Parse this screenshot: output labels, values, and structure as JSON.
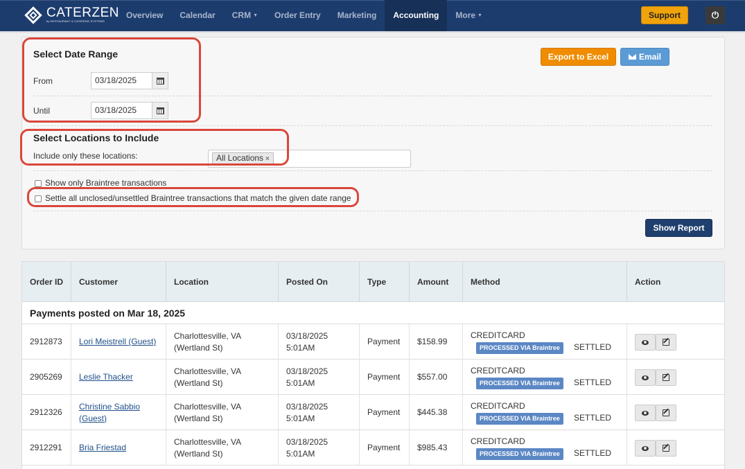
{
  "nav": {
    "brand": "CATERZEN",
    "brand_tag": "by RESTAURANT & CATERING SYSTEMS",
    "links": [
      {
        "label": "Overview"
      },
      {
        "label": "Calendar"
      },
      {
        "label": "CRM",
        "caret": "▼"
      },
      {
        "label": "Order Entry"
      },
      {
        "label": "Marketing"
      },
      {
        "label": "Accounting",
        "active": true
      },
      {
        "label": "More",
        "caret": "▼"
      }
    ],
    "support_label": "Support",
    "power_icon": "⏻"
  },
  "filters": {
    "date_heading": "Select Date Range",
    "from_label": "From",
    "from_value": "03/18/2025",
    "until_label": "Until",
    "until_value": "03/18/2025",
    "locations_heading": "Select Locations to Include",
    "locations_label": "Include only these locations:",
    "location_chip": "All Locations",
    "chip_remove": "×",
    "braintree_only_label": "Show only Braintree transactions",
    "settle_label": "Settle all unclosed/unsettled Braintree transactions that match the given date range",
    "export_label": "Export to Excel",
    "email_label": "Email",
    "show_report_label": "Show Report"
  },
  "table": {
    "headers": {
      "order_id": "Order ID",
      "customer": "Customer",
      "location": "Location",
      "posted_on": "Posted On",
      "type": "Type",
      "amount": "Amount",
      "method": "Method",
      "action": "Action"
    },
    "group_label": "Payments posted on Mar 18, 2025",
    "rows": [
      {
        "order_id": "2912873",
        "customer": "Lori Meistrell (Guest)",
        "location": "Charlottesville, VA (Wertland St)",
        "date": "03/18/2025",
        "time": "5:01AM",
        "type": "Payment",
        "amount": "$158.99",
        "method": "CREDITCARD",
        "badge": "PROCESSED VIA Braintree",
        "status": "SETTLED"
      },
      {
        "order_id": "2905269",
        "customer": "Leslie Thacker",
        "location": "Charlottesville, VA (Wertland St)",
        "date": "03/18/2025",
        "time": "5:01AM",
        "type": "Payment",
        "amount": "$557.00",
        "method": "CREDITCARD",
        "badge": "PROCESSED VIA Braintree",
        "status": "SETTLED"
      },
      {
        "order_id": "2912326",
        "customer": "Christine Sabbio (Guest)",
        "location": "Charlottesville, VA (Wertland St)",
        "date": "03/18/2025",
        "time": "5:01AM",
        "type": "Payment",
        "amount": "$445.38",
        "method": "CREDITCARD",
        "badge": "PROCESSED VIA Braintree",
        "status": "SETTLED"
      },
      {
        "order_id": "2912291",
        "customer": "Bria Friestad",
        "location": "Charlottesville, VA (Wertland St)",
        "date": "03/18/2025",
        "time": "5:01AM",
        "type": "Payment",
        "amount": "$985.43",
        "method": "CREDITCARD",
        "badge": "PROCESSED VIA Braintree",
        "status": "SETTLED"
      }
    ]
  },
  "colors": {
    "navbar": "#1d3c6e",
    "highlight": "#d9473a",
    "export": "#f08c00",
    "email": "#5b9bd5",
    "report": "#1f3f6e",
    "badge": "#5b87c4"
  }
}
